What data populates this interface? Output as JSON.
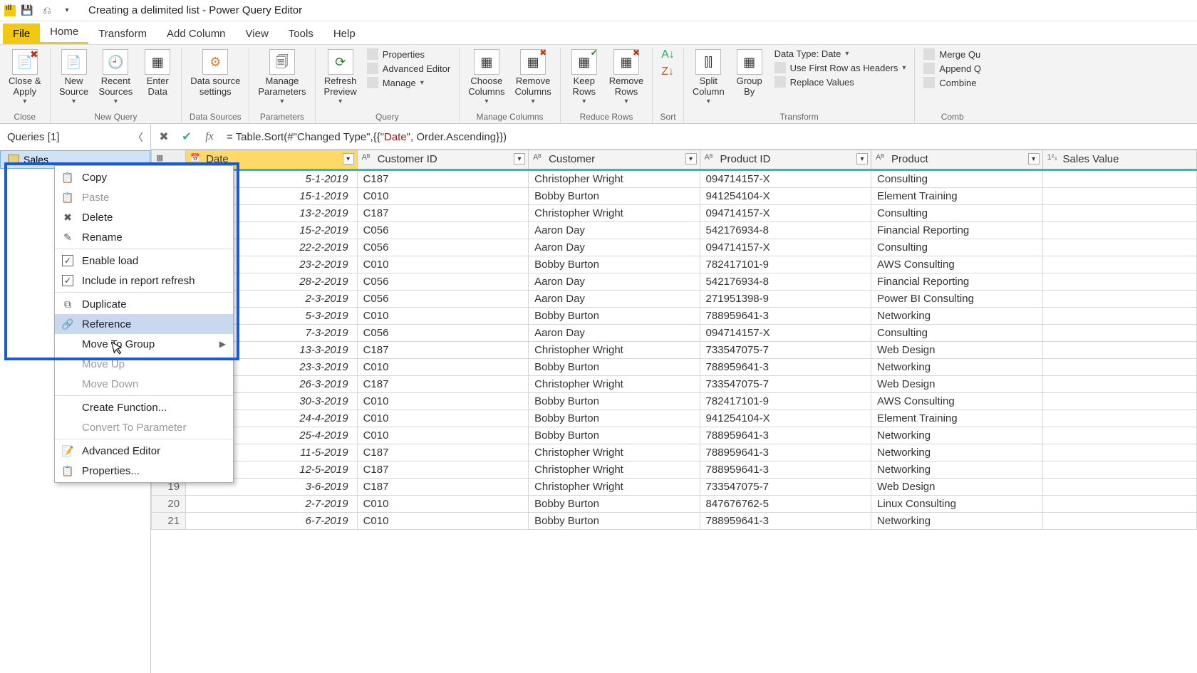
{
  "title": "Creating a delimited list - Power Query Editor",
  "tabs": {
    "file": "File",
    "home": "Home",
    "transform": "Transform",
    "addcol": "Add Column",
    "view": "View",
    "tools": "Tools",
    "help": "Help"
  },
  "ribbon": {
    "close_apply": "Close &\nApply",
    "close_group": "Close",
    "new_source": "New\nSource",
    "recent_sources": "Recent\nSources",
    "enter_data": "Enter\nData",
    "new_query_group": "New Query",
    "data_source_settings": "Data source\nsettings",
    "data_sources_group": "Data Sources",
    "manage_parameters": "Manage\nParameters",
    "parameters_group": "Parameters",
    "refresh_preview": "Refresh\nPreview",
    "properties": "Properties",
    "advanced_editor": "Advanced Editor",
    "manage": "Manage",
    "query_group": "Query",
    "choose_columns": "Choose\nColumns",
    "remove_columns": "Remove\nColumns",
    "manage_columns_group": "Manage Columns",
    "keep_rows": "Keep\nRows",
    "remove_rows": "Remove\nRows",
    "reduce_rows_group": "Reduce Rows",
    "sort_group": "Sort",
    "split_column": "Split\nColumn",
    "group_by": "Group\nBy",
    "data_type": "Data Type: Date",
    "first_row_headers": "Use First Row as Headers",
    "replace_values": "Replace Values",
    "transform_group": "Transform",
    "merge": "Merge Qu",
    "append": "Append Q",
    "combine_files": "Combine",
    "combine_group": "Comb"
  },
  "queries_header": "Queries [1]",
  "query_name": "Sales",
  "formula_prefix": "= Table.Sort(#\"Changed Type\",{{",
  "formula_str": "\"Date\"",
  "formula_suffix": ", Order.Ascending}})",
  "columns": {
    "rownum": "",
    "date": "Date",
    "customer_id": "Customer ID",
    "customer": "Customer",
    "product_id": "Product ID",
    "product": "Product",
    "sales_value": "Sales Value"
  },
  "rows": [
    {
      "n": "",
      "date": "5-1-2019",
      "cid": "C187",
      "cust": "Christopher Wright",
      "pid": "094714157-X",
      "prod": "Consulting",
      "val": ""
    },
    {
      "n": "",
      "date": "15-1-2019",
      "cid": "C010",
      "cust": "Bobby Burton",
      "pid": "941254104-X",
      "prod": "Element Training",
      "val": ""
    },
    {
      "n": "",
      "date": "13-2-2019",
      "cid": "C187",
      "cust": "Christopher Wright",
      "pid": "094714157-X",
      "prod": "Consulting",
      "val": ""
    },
    {
      "n": "",
      "date": "15-2-2019",
      "cid": "C056",
      "cust": "Aaron Day",
      "pid": "542176934-8",
      "prod": "Financial Reporting",
      "val": ""
    },
    {
      "n": "",
      "date": "22-2-2019",
      "cid": "C056",
      "cust": "Aaron Day",
      "pid": "094714157-X",
      "prod": "Consulting",
      "val": ""
    },
    {
      "n": "",
      "date": "23-2-2019",
      "cid": "C010",
      "cust": "Bobby Burton",
      "pid": "782417101-9",
      "prod": "AWS Consulting",
      "val": ""
    },
    {
      "n": "",
      "date": "28-2-2019",
      "cid": "C056",
      "cust": "Aaron Day",
      "pid": "542176934-8",
      "prod": "Financial Reporting",
      "val": ""
    },
    {
      "n": "",
      "date": "2-3-2019",
      "cid": "C056",
      "cust": "Aaron Day",
      "pid": "271951398-9",
      "prod": "Power BI Consulting",
      "val": ""
    },
    {
      "n": "",
      "date": "5-3-2019",
      "cid": "C010",
      "cust": "Bobby Burton",
      "pid": "788959641-3",
      "prod": "Networking",
      "val": ""
    },
    {
      "n": "",
      "date": "7-3-2019",
      "cid": "C056",
      "cust": "Aaron Day",
      "pid": "094714157-X",
      "prod": "Consulting",
      "val": ""
    },
    {
      "n": "",
      "date": "13-3-2019",
      "cid": "C187",
      "cust": "Christopher Wright",
      "pid": "733547075-7",
      "prod": "Web Design",
      "val": ""
    },
    {
      "n": "",
      "date": "23-3-2019",
      "cid": "C010",
      "cust": "Bobby Burton",
      "pid": "788959641-3",
      "prod": "Networking",
      "val": ""
    },
    {
      "n": "",
      "date": "26-3-2019",
      "cid": "C187",
      "cust": "Christopher Wright",
      "pid": "733547075-7",
      "prod": "Web Design",
      "val": ""
    },
    {
      "n": "",
      "date": "30-3-2019",
      "cid": "C010",
      "cust": "Bobby Burton",
      "pid": "782417101-9",
      "prod": "AWS Consulting",
      "val": ""
    },
    {
      "n": "",
      "date": "24-4-2019",
      "cid": "C010",
      "cust": "Bobby Burton",
      "pid": "941254104-X",
      "prod": "Element Training",
      "val": ""
    },
    {
      "n": "",
      "date": "25-4-2019",
      "cid": "C010",
      "cust": "Bobby Burton",
      "pid": "788959641-3",
      "prod": "Networking",
      "val": ""
    },
    {
      "n": "",
      "date": "11-5-2019",
      "cid": "C187",
      "cust": "Christopher Wright",
      "pid": "788959641-3",
      "prod": "Networking",
      "val": ""
    },
    {
      "n": "18",
      "date": "12-5-2019",
      "cid": "C187",
      "cust": "Christopher Wright",
      "pid": "788959641-3",
      "prod": "Networking",
      "val": ""
    },
    {
      "n": "19",
      "date": "3-6-2019",
      "cid": "C187",
      "cust": "Christopher Wright",
      "pid": "733547075-7",
      "prod": "Web Design",
      "val": ""
    },
    {
      "n": "20",
      "date": "2-7-2019",
      "cid": "C010",
      "cust": "Bobby Burton",
      "pid": "847676762-5",
      "prod": "Linux Consulting",
      "val": ""
    },
    {
      "n": "21",
      "date": "6-7-2019",
      "cid": "C010",
      "cust": "Bobby Burton",
      "pid": "788959641-3",
      "prod": "Networking",
      "val": ""
    }
  ],
  "context_menu": {
    "copy": "Copy",
    "paste": "Paste",
    "delete": "Delete",
    "rename": "Rename",
    "enable_load": "Enable load",
    "include_refresh": "Include in report refresh",
    "duplicate": "Duplicate",
    "reference": "Reference",
    "move_group": "Move To Group",
    "move_up": "Move Up",
    "move_down": "Move Down",
    "create_function": "Create Function...",
    "convert_param": "Convert To Parameter",
    "advanced_editor": "Advanced Editor",
    "properties": "Properties..."
  }
}
